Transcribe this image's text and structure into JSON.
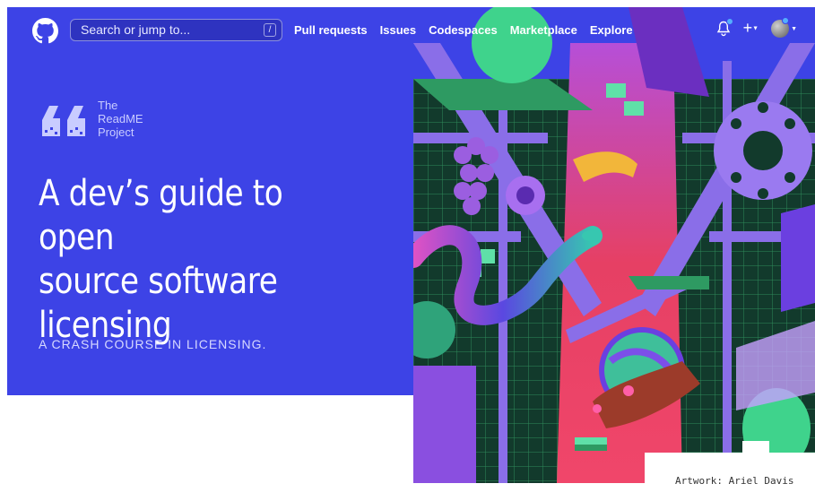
{
  "nav": {
    "search_placeholder": "Search or jump to...",
    "search_shortcut": "/",
    "links": [
      "Pull requests",
      "Issues",
      "Codespaces",
      "Marketplace",
      "Explore"
    ]
  },
  "hero": {
    "brand_lines": [
      "The",
      "ReadME",
      "Project"
    ],
    "title_lines": [
      "A dev’s guide to open",
      "source software",
      "licensing"
    ],
    "subtitle": "A CRASH COURSE IN LICENSING."
  },
  "artwork": {
    "credit": "Artwork: Ariel Davis"
  },
  "colors": {
    "hero_blue": "#3d43e6",
    "art_pink": "#e0405f",
    "art_green": "#1f6b4a",
    "art_purple": "#8a5bd6"
  },
  "icons": [
    "github-logo-icon",
    "bell-icon",
    "plus-icon",
    "avatar"
  ]
}
